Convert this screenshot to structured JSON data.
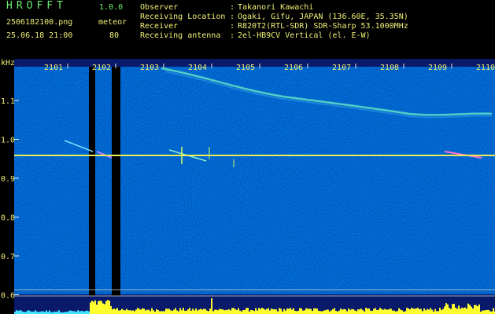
{
  "app": {
    "title": "HROFFT",
    "version": "1.0.0",
    "file_name": "2506182100.png",
    "meteor_label": "meteor",
    "date_time": "25.06.18 21:00",
    "meteor_count": "80"
  },
  "info": [
    {
      "key": "Observer",
      "value": "Takanori Kawachi"
    },
    {
      "key": "Receiving Location",
      "value": "Ogaki, Gifu, JAPAN (136.60E, 35.35N)"
    },
    {
      "key": "Receiver",
      "value": "R820T2(RTL-SDR) SDR-Sharp 53.1000MHz"
    },
    {
      "key": "Receiving antenna",
      "value": "2el-HB9CV Vertical (el. E-W)"
    }
  ],
  "spectrogram": {
    "unit_label": "kHz",
    "y_ticks": [
      "1.1",
      "1.0",
      "0.9",
      "0.8",
      "0.7",
      "0.6"
    ],
    "x_ticks": [
      "2101",
      "2102",
      "2103",
      "2104",
      "2105",
      "2106",
      "2107",
      "2108",
      "2109",
      "2110"
    ],
    "colors": {
      "text": "#f0f078",
      "tick": "#e8e8e8",
      "noise": "#0a1a6a",
      "carrier": "#d8ff60"
    }
  }
}
